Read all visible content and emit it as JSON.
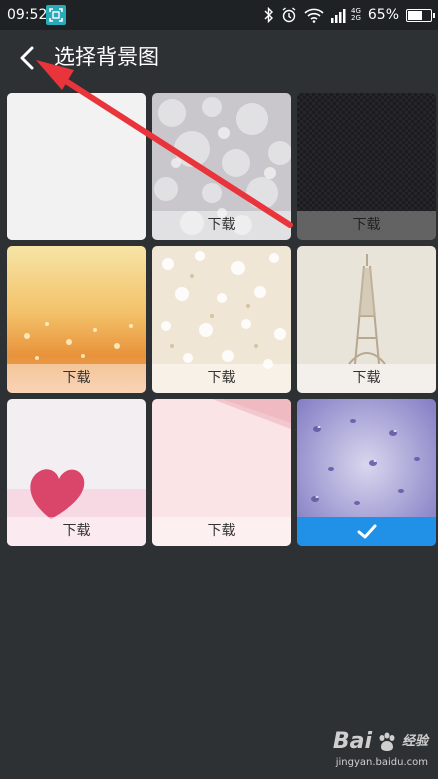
{
  "status_bar": {
    "time": "09:52",
    "network_top": "4G",
    "network_bottom": "2G",
    "battery_text": "65%",
    "battery_level": 0.65
  },
  "header": {
    "title": "选择背景图"
  },
  "wallpapers": [
    {
      "label": "",
      "state": "plain"
    },
    {
      "label": "下载",
      "state": "download"
    },
    {
      "label": "下载",
      "state": "download"
    },
    {
      "label": "下载",
      "state": "download"
    },
    {
      "label": "下载",
      "state": "download"
    },
    {
      "label": "下载",
      "state": "download"
    },
    {
      "label": "下载",
      "state": "download"
    },
    {
      "label": "下载",
      "state": "download"
    },
    {
      "label": "",
      "state": "selected"
    }
  ],
  "colors": {
    "background": "#2e3134",
    "accent": "#2191e8",
    "annotation_arrow": "#e8343a"
  },
  "watermark": {
    "brand": "Bai",
    "brand_suffix": "经验",
    "url": "jingyan.baidu.com"
  }
}
